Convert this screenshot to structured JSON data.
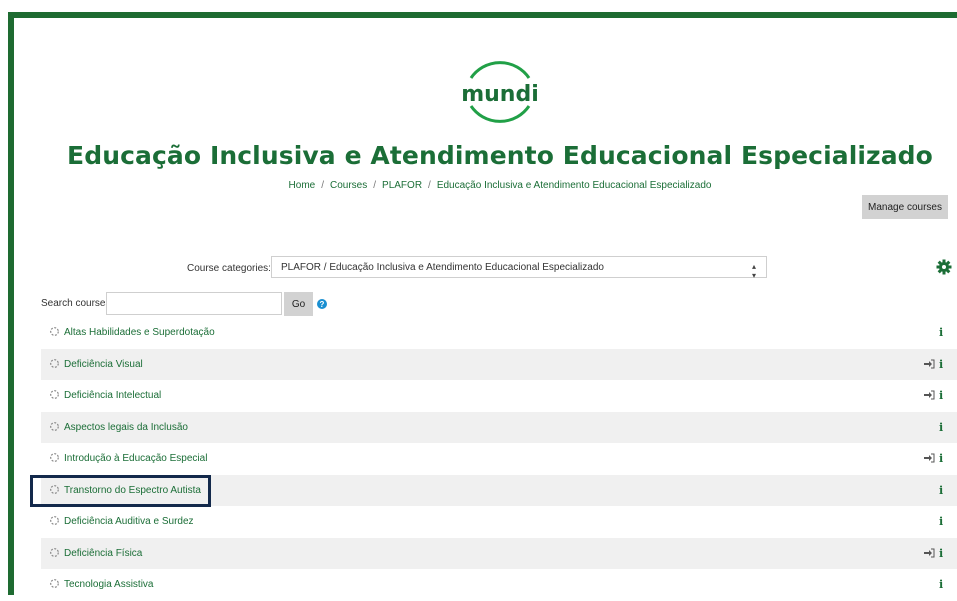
{
  "site": {
    "logo_text": "mundi",
    "title": "Educação Inclusiva e Atendimento Educacional Especializado"
  },
  "breadcrumb": [
    "Home",
    "Courses",
    "PLAFOR",
    "Educação Inclusiva e Atendimento Educacional Especializado"
  ],
  "buttons": {
    "manage_courses": "Manage courses",
    "go": "Go"
  },
  "filters": {
    "category_label": "Course categories:",
    "category_value": "PLAFOR / Educação Inclusiva e Atendimento Educacional Especializado",
    "search_label": "Search courses",
    "search_value": "",
    "search_placeholder": ""
  },
  "icons": {
    "gear": "gear-icon",
    "help": "help-icon",
    "course": "course-icon",
    "enrol": "enrol-icon",
    "info": "info-icon"
  },
  "colors": {
    "brand_green": "#1b6e37",
    "frame_green": "#1e6b31",
    "highlight_navy": "#13294b",
    "help_blue": "#1a8fd1"
  },
  "courses": [
    {
      "name": "Altas Habilidades e Superdotação",
      "enrol": false,
      "info": "i"
    },
    {
      "name": "Deficiência Visual",
      "enrol": true,
      "info": "i"
    },
    {
      "name": "Deficiência Intelectual",
      "enrol": true,
      "info": "i"
    },
    {
      "name": "Aspectos legais da Inclusão",
      "enrol": false,
      "info": "i"
    },
    {
      "name": "Introdução à Educação Especial",
      "enrol": true,
      "info": "i"
    },
    {
      "name": "Transtorno do Espectro Autista",
      "enrol": false,
      "info": "i",
      "highlighted": true
    },
    {
      "name": "Deficiência Auditiva e Surdez",
      "enrol": false,
      "info": "i"
    },
    {
      "name": "Deficiência Física",
      "enrol": true,
      "info": "i"
    },
    {
      "name": "Tecnologia Assistiva",
      "enrol": false,
      "info": "i"
    }
  ]
}
